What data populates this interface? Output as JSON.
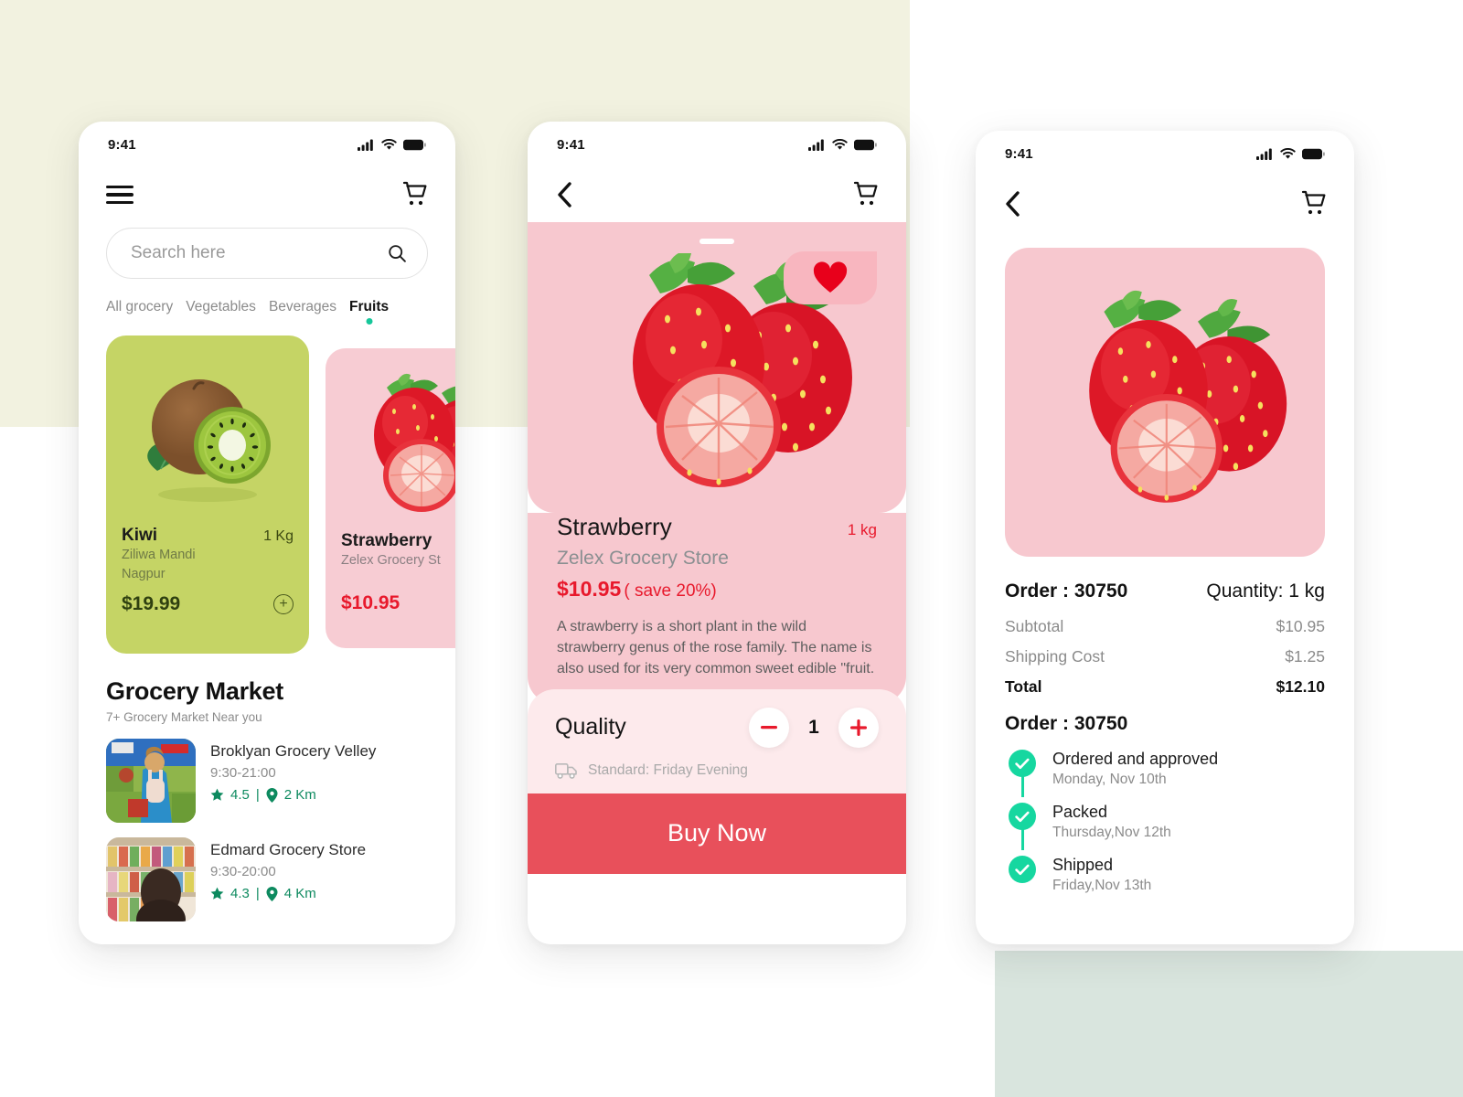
{
  "colors": {
    "bg_cream": "#f2f2e0",
    "bg_sage": "#d9e5de",
    "kiwi_card": "#c5d465",
    "strawberry_card": "#f7ccd3",
    "accent_red": "#e8192c",
    "buy_button": "#e8505b",
    "timeline_green": "#16d7a0",
    "rating_green": "#0d8a5f",
    "tab_dot": "#16c79a"
  },
  "status_bar": {
    "time": "9:41",
    "icons": [
      "cellular-signal-icon",
      "wifi-icon",
      "battery-icon"
    ]
  },
  "phone1": {
    "nav": {
      "menu_icon": "hamburger-menu-icon",
      "cart_icon": "shopping-cart-icon"
    },
    "search": {
      "placeholder": "Search here",
      "value": "",
      "icon": "search-icon"
    },
    "tabs": [
      {
        "label": "All grocery",
        "active": false
      },
      {
        "label": "Vegetables",
        "active": false
      },
      {
        "label": "Beverages",
        "active": false
      },
      {
        "label": "Fruits",
        "active": true
      }
    ],
    "products": [
      {
        "name": "Kiwi",
        "unit": "1 Kg",
        "store": "Ziliwa Mandi",
        "location": "Nagpur",
        "price": "$19.99",
        "add_icon": "plus-circle-icon"
      },
      {
        "name": "Strawberry",
        "store": "Zelex Grocery St",
        "price": "$10.95"
      }
    ],
    "section": {
      "title": "Grocery Market",
      "subtitle": "7+ Grocery Market Near you"
    },
    "stores": [
      {
        "name": "Broklyan Grocery Velley",
        "hours": "9:30-21:00",
        "rating": "4.5",
        "separator": "|",
        "distance": "2 Km"
      },
      {
        "name": "Edmard Grocery Store",
        "hours": "9:30-20:00",
        "rating": "4.3",
        "separator": "|",
        "distance": "4 Km"
      }
    ]
  },
  "phone2": {
    "nav": {
      "back_icon": "chevron-left-icon",
      "cart_icon": "shopping-cart-icon"
    },
    "favorite": {
      "icon": "heart-icon",
      "active": true
    },
    "product": {
      "name": "Strawberry",
      "unit": "1 kg",
      "store": "Zelex Grocery Store",
      "price": "$10.95",
      "save": "( save 20%)",
      "description": "A strawberry is a short plant in the wild strawberry genus of the rose family. The name is also used for its very common sweet edible \"fruit."
    },
    "quality": {
      "label": "Quality",
      "minus_icon": "minus-icon",
      "plus_icon": "plus-icon",
      "value": "1"
    },
    "shipping": {
      "icon": "truck-icon",
      "text": "Standard: Friday Evening"
    },
    "buy_button": "Buy Now"
  },
  "phone3": {
    "nav": {
      "back_icon": "chevron-left-icon",
      "cart_icon": "shopping-cart-icon"
    },
    "order": {
      "number_label": "Order : 30750",
      "quantity_label": "Quantity: 1 kg",
      "number_label_2": "Order : 30750"
    },
    "summary": [
      {
        "label": "Subtotal",
        "value": "$10.95",
        "bold": false
      },
      {
        "label": "Shipping Cost",
        "value": "$1.25",
        "bold": false
      },
      {
        "label": "Total",
        "value": "$12.10",
        "bold": true
      }
    ],
    "timeline": [
      {
        "title": "Ordered and approved",
        "date": "Monday, Nov 10th",
        "icon": "check-circle-icon"
      },
      {
        "title": "Packed",
        "date": "Thursday,Nov 12th",
        "icon": "check-circle-icon"
      },
      {
        "title": "Shipped",
        "date": "Friday,Nov 13th",
        "icon": "check-circle-icon"
      }
    ]
  }
}
